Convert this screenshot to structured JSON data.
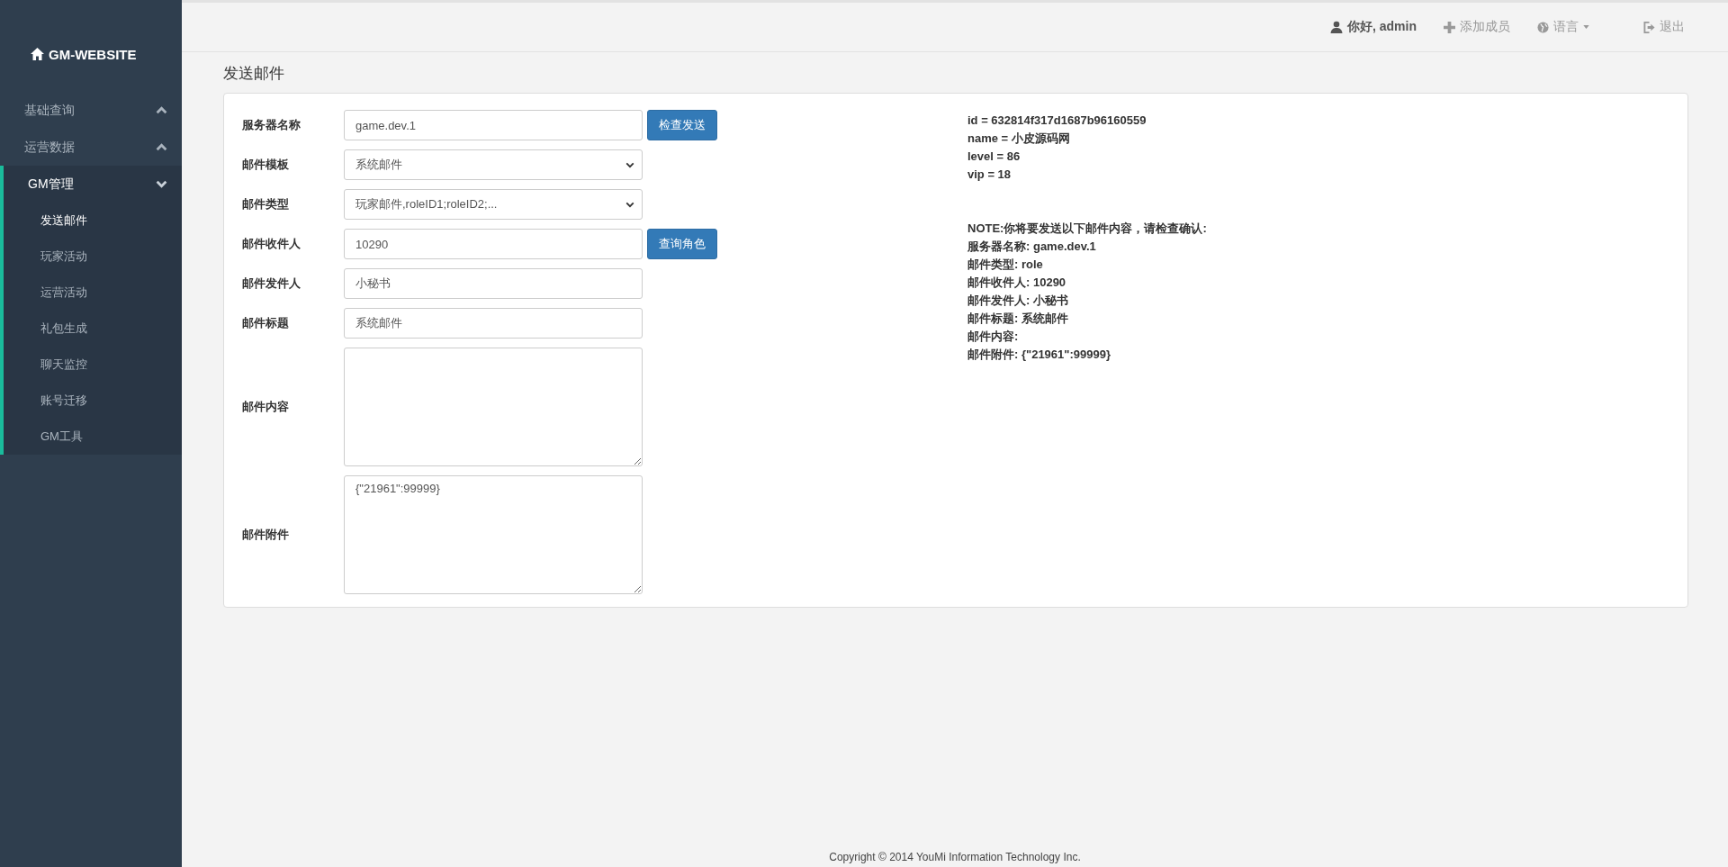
{
  "sidebar": {
    "brand": "GM-WEBSITE",
    "items": [
      {
        "label": "基础查询",
        "expanded": false
      },
      {
        "label": "运营数据",
        "expanded": false
      },
      {
        "label": "GM管理",
        "expanded": true,
        "children": [
          {
            "label": "发送邮件",
            "selected": true
          },
          {
            "label": "玩家活动",
            "selected": false
          },
          {
            "label": "运营活动",
            "selected": false
          },
          {
            "label": "礼包生成",
            "selected": false
          },
          {
            "label": "聊天监控",
            "selected": false
          },
          {
            "label": "账号迁移",
            "selected": false
          },
          {
            "label": "GM工具",
            "selected": false
          }
        ]
      }
    ]
  },
  "topbar": {
    "greeting": "你好, admin",
    "add_member": "添加成员",
    "language": "语言",
    "logout": "退出"
  },
  "page_title": "发送邮件",
  "form": {
    "rows": [
      {
        "kind": "input",
        "label": "服务器名称",
        "value": "game.dev.1",
        "button": "检查发送"
      },
      {
        "kind": "select",
        "label": "邮件模板",
        "value": "系统邮件"
      },
      {
        "kind": "select",
        "label": "邮件类型",
        "value": "玩家邮件,roleID1;roleID2;..."
      },
      {
        "kind": "input",
        "label": "邮件收件人",
        "value": "10290",
        "button": "查询角色"
      },
      {
        "kind": "input",
        "label": "邮件发件人",
        "value": "小秘书"
      },
      {
        "kind": "input",
        "label": "邮件标题",
        "value": "系统邮件"
      },
      {
        "kind": "textarea",
        "label": "邮件内容"
      },
      {
        "kind": "textarea",
        "label": "邮件附件",
        "value": "{\"21961\":99999}"
      }
    ]
  },
  "info": {
    "record": [
      "id = 632814f317d1687b96160559",
      "name = 小皮源码网",
      "level = 86",
      "vip = 18"
    ],
    "summary": [
      "NOTE:你将要发送以下邮件内容，请检查确认:",
      "服务器名称: game.dev.1",
      "邮件类型: role",
      "邮件收件人: 10290",
      "邮件发件人: 小秘书",
      "邮件标题: 系统邮件",
      "邮件内容:",
      "邮件附件: {\"21961\":99999}"
    ]
  },
  "footer": "Copyright © 2014 YouMi Information Technology Inc."
}
